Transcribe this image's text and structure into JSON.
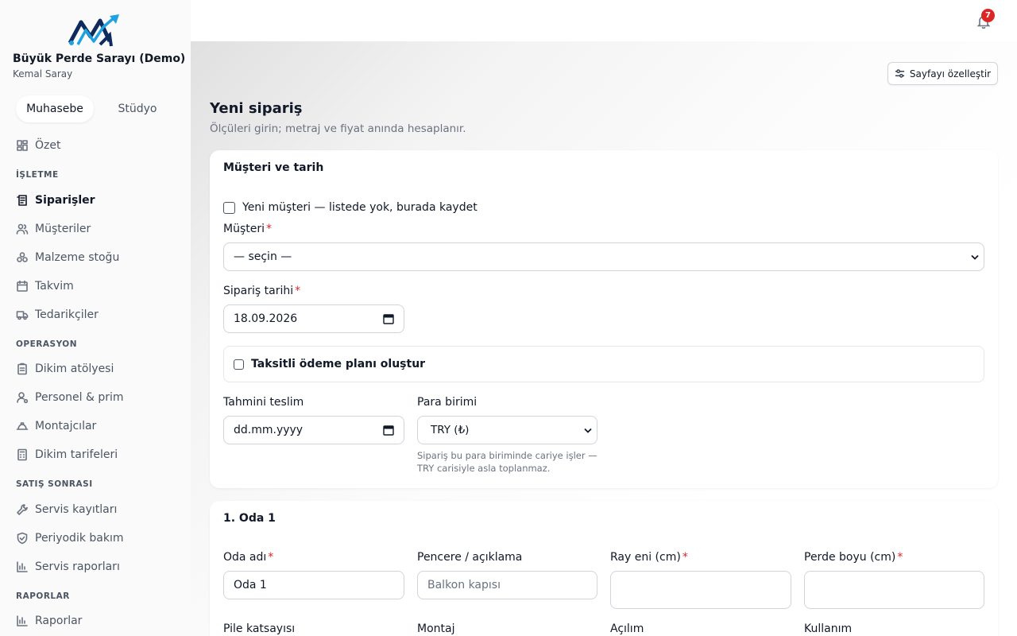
{
  "sidebar": {
    "business_name": "Büyük Perde Sarayı (Demo)",
    "user_name": "Kemal Saray",
    "tabs": [
      {
        "label": "Muhasebe",
        "active": true
      },
      {
        "label": "Stüdyo",
        "active": false
      }
    ],
    "summary": {
      "label": "Özet",
      "icon": "dashboard-icon"
    },
    "sections": [
      {
        "title": "İŞLETME",
        "items": [
          {
            "label": "Siparişler",
            "icon": "orders-icon",
            "active": true
          },
          {
            "label": "Müşteriler",
            "icon": "users-icon"
          },
          {
            "label": "Malzeme stoğu",
            "icon": "stock-icon"
          },
          {
            "label": "Takvim",
            "icon": "calendar-icon"
          },
          {
            "label": "Tedarikçiler",
            "icon": "truck-icon"
          }
        ]
      },
      {
        "title": "OPERASYON",
        "items": [
          {
            "label": "Dikim atölyesi",
            "icon": "clipboard-icon"
          },
          {
            "label": "Personel & prim",
            "icon": "user-icon"
          },
          {
            "label": "Montajcılar",
            "icon": "hardhat-icon"
          },
          {
            "label": "Dikim tarifeleri",
            "icon": "calculator-icon"
          }
        ]
      },
      {
        "title": "SATIŞ SONRASI",
        "items": [
          {
            "label": "Servis kayıtları",
            "icon": "wrench-icon"
          },
          {
            "label": "Periyodik bakım",
            "icon": "shield-icon"
          },
          {
            "label": "Servis raporları",
            "icon": "bar-chart-icon"
          }
        ]
      },
      {
        "title": "RAPORLAR",
        "items": [
          {
            "label": "Raporlar",
            "icon": "bar-chart-icon"
          }
        ]
      }
    ]
  },
  "header": {
    "notification_count": "7",
    "customize_label": "Sayfayı özelleştir"
  },
  "page": {
    "title": "Yeni sipariş",
    "subtitle": "Ölçüleri girin; metraj ve fiyat anında hesaplanır."
  },
  "customer_card": {
    "title": "Müşteri ve tarih",
    "new_customer_label": "Yeni müşteri — listede yok, burada kaydet",
    "customer_label": "Müşteri",
    "customer_value": "— seçin —",
    "order_date_label": "Sipariş tarihi",
    "order_date_value": "18.09.2026",
    "installment_label": "Taksitli ödeme planı oluştur",
    "delivery_label": "Tahmini teslim",
    "delivery_placeholder": "dd.mm.yyyy",
    "currency_label": "Para birimi",
    "currency_value": "TRY (₺)",
    "currency_hint_1": "Sipariş bu para biriminde cariye işler —",
    "currency_hint_2": "TRY carisiyle asla toplanmaz."
  },
  "room_card": {
    "title": "1. Oda 1",
    "room_name_label": "Oda adı",
    "room_name_value": "Oda 1",
    "window_label": "Pencere / açıklama",
    "window_placeholder": "Balkon kapısı",
    "rail_width_label": "Ray eni (cm)",
    "curtain_height_label": "Perde boyu (cm)",
    "pleat_label": "Pile katsayısı",
    "install_label": "Montaj",
    "opening_label": "Açılım",
    "usage_label": "Kullanım"
  },
  "colors": {
    "required": "#dc2626",
    "badge": "#dc2626",
    "logo_dark": "#0f2a5c",
    "logo_light": "#1fa2e0"
  }
}
